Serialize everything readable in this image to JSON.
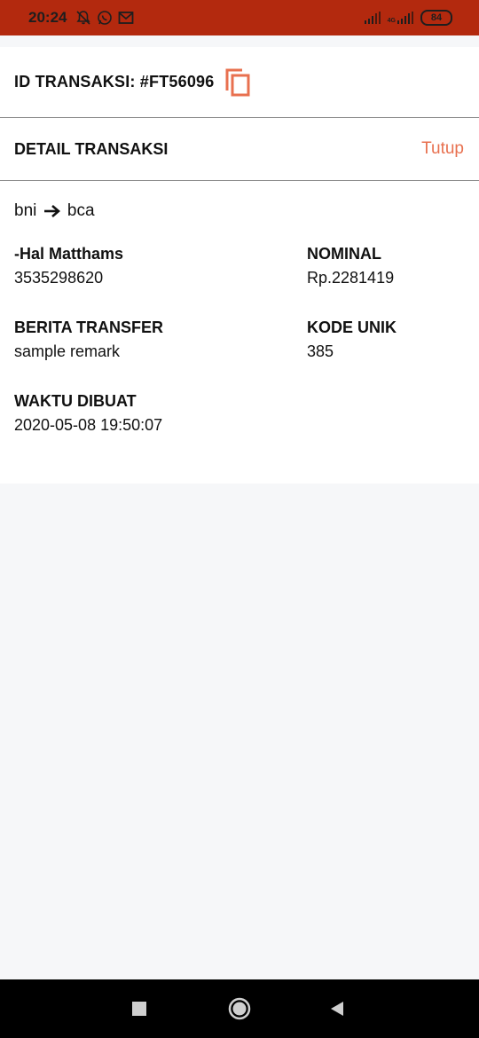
{
  "status_bar": {
    "time": "20:24",
    "battery": "84",
    "network": "4G"
  },
  "transaction": {
    "id_label": "ID TRANSAKSI: #FT56096",
    "detail_title": "DETAIL TRANSAKSI",
    "close_label": "Tutup",
    "route_from": "bni",
    "route_to": "bca",
    "fields": {
      "name_label": "-Hal Matthams",
      "name_value": "3535298620",
      "nominal_label": "NOMINAL",
      "nominal_value": "Rp.2281419",
      "remark_label": "BERITA TRANSFER",
      "remark_value": "sample remark",
      "unique_label": "KODE UNIK",
      "unique_value": "385",
      "created_label": "WAKTU DIBUAT",
      "created_value": "2020-05-08 19:50:07"
    }
  },
  "colors": {
    "status_bar": "#b3290e",
    "accent": "#e8704f"
  }
}
